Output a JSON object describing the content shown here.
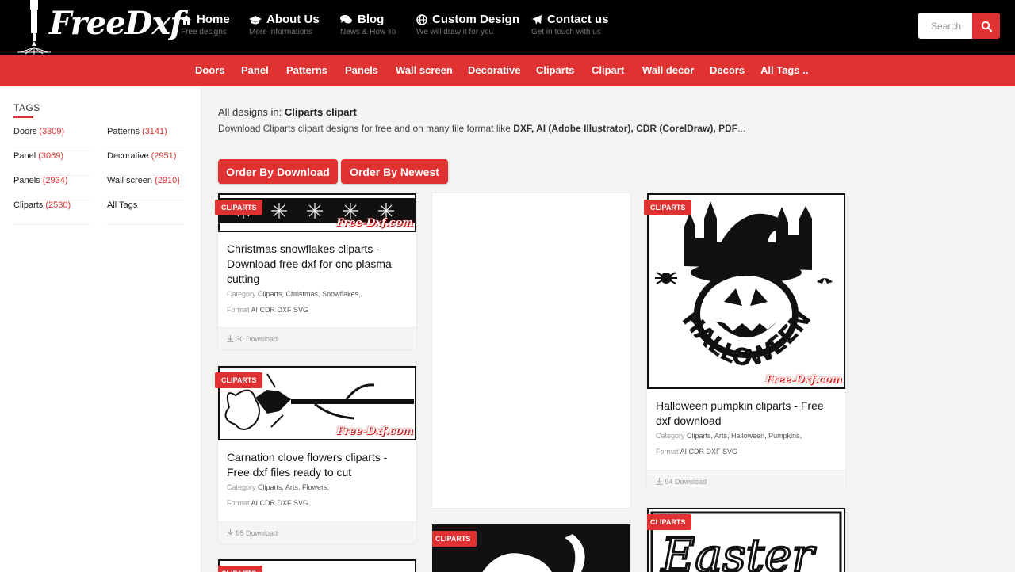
{
  "header": {
    "logo_text": "FreeDxf",
    "nav": [
      {
        "title": "Home",
        "sub": "Free designs",
        "icon": "home-icon"
      },
      {
        "title": "About Us",
        "sub": "More informations",
        "icon": "graduation-cap-icon"
      },
      {
        "title": "Blog",
        "sub": "News & How To",
        "icon": "comments-icon"
      },
      {
        "title": "Custom Design",
        "sub": "We will draw it for you",
        "icon": "globe-icon"
      },
      {
        "title": "Contact us",
        "sub": "Get in touch with us",
        "icon": "paper-plane-icon"
      }
    ],
    "search": {
      "placeholder": "Search",
      "icon": "search-icon"
    },
    "colors": {
      "bar": "#000000",
      "accent": "#e03232"
    }
  },
  "categories": [
    "Doors",
    "Panel",
    "Patterns",
    "Panels",
    "Wall screen",
    "Decorative",
    "Cliparts",
    "Clipart",
    "Wall decor",
    "Decors",
    "All Tags .."
  ],
  "sidebar": {
    "title": "TAGS",
    "tags": [
      {
        "name": "Doors",
        "count": "(3309)"
      },
      {
        "name": "Patterns",
        "count": "(3141)"
      },
      {
        "name": "Panel",
        "count": "(3069)"
      },
      {
        "name": "Decorative",
        "count": "(2951)"
      },
      {
        "name": "Panels",
        "count": "(2934)"
      },
      {
        "name": "Wall screen",
        "count": "(2910)"
      },
      {
        "name": "Cliparts",
        "count": "(2530)"
      },
      {
        "name": "All Tags",
        "count": ""
      }
    ]
  },
  "main": {
    "intro_prefix": "All designs in:",
    "intro_name": "Cliparts clipart",
    "desc_prefix": "Download Cliparts clipart designs for free and on many file format like",
    "desc_formats": "DXF, AI (Adobe Illustrator), CDR (CorelDraw), PDF",
    "desc_suffix": "...",
    "order_download": "Order By Download",
    "order_newest": "Order By Newest"
  },
  "cards": [
    {
      "badge": "CLIPARTS",
      "watermark": "Free-Dxf.com",
      "title": "Christmas snowflakes cliparts - Download free dxf for cnc plasma cutting",
      "category_label": "Category",
      "categories": "Cliparts, Christmas, Snowflakes,",
      "format_label": "Format",
      "formats": "AI CDR DXF SVG",
      "downloads": "30 Download"
    },
    {
      "badge": "CLIPARTS",
      "watermark": "Free-Dxf.com",
      "title": "Carnation clove flowers cliparts - Free dxf files ready to cut",
      "category_label": "Category",
      "categories": "Cliparts, Arts, Flowers,",
      "format_label": "Format",
      "formats": "AI CDR DXF SVG",
      "downloads": "95 Download"
    },
    {
      "badge": "CLIPARTS",
      "watermark": "Free-Dxf.com",
      "image_text": "HALLOWEEN",
      "title": "Halloween pumpkin cliparts - Free dxf download",
      "category_label": "Category",
      "categories": "Cliparts, Arts, Halloween, Pumpkins,",
      "format_label": "Format",
      "formats": "AI CDR DXF SVG",
      "downloads": "94 Download"
    },
    {
      "badge": "CLIPARTS"
    },
    {
      "badge": "CLIPARTS",
      "image_text": "Easter"
    }
  ]
}
